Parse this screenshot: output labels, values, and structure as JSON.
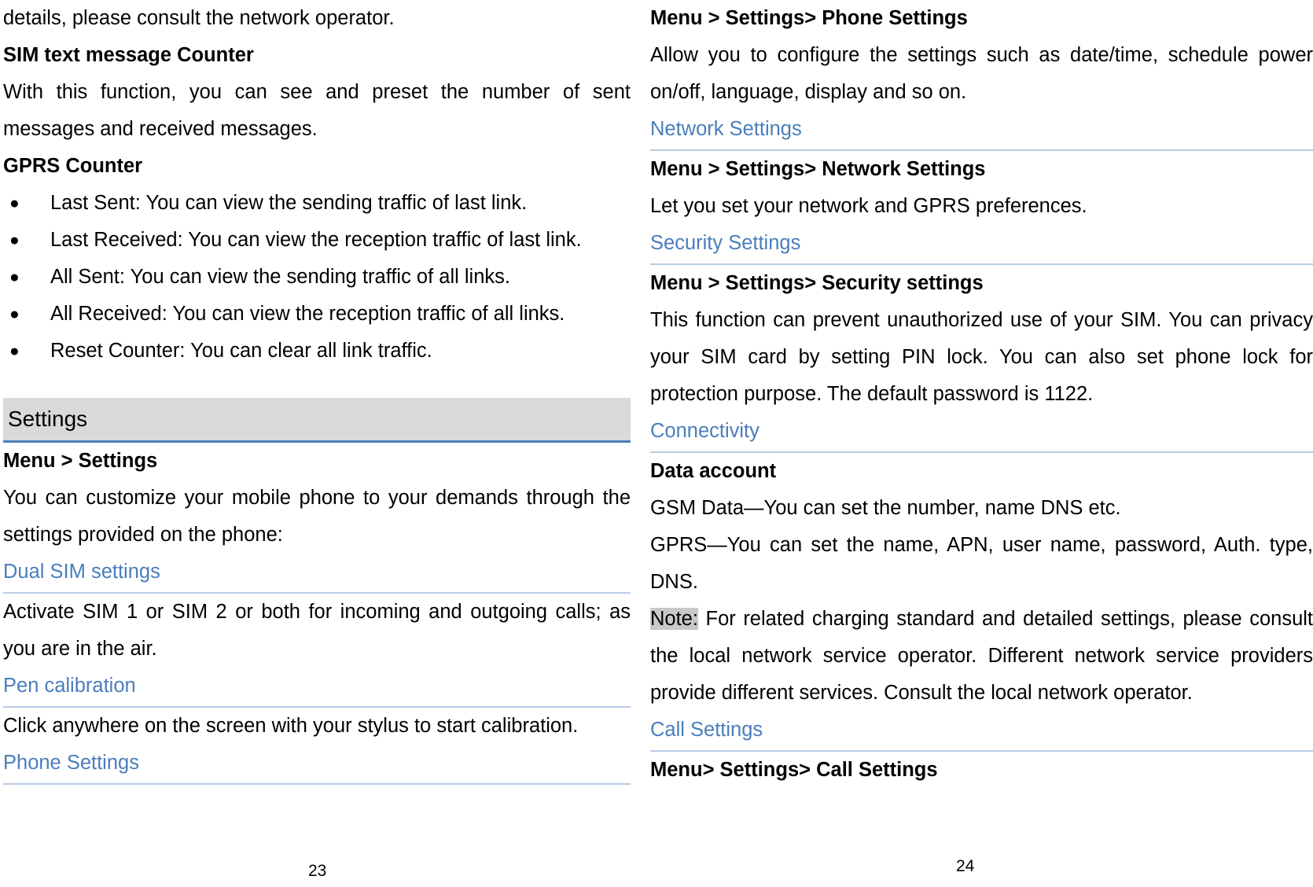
{
  "document": {
    "type": "user-manual",
    "page_numbers": {
      "left": "23",
      "right": "24"
    }
  },
  "left_column": {
    "intro_paragraph": "details, please consult the network operator.",
    "sim_counter_heading": "SIM text message Counter",
    "sim_counter_body": "With this function, you can see and preset the number of sent messages and received messages.",
    "gprs_counter_heading": "GPRS Counter",
    "gprs_bullets": [
      "Last Sent: You can view the sending traffic of last link.",
      "Last Received: You can view the reception traffic of last link.",
      "All Sent: You can view the sending traffic of all links.",
      "All Received: You can view the reception traffic of all links.",
      "Reset Counter: You can clear all link traffic."
    ],
    "settings_banner": "Settings",
    "menu_settings_heading": "Menu > Settings",
    "menu_settings_body": "You can customize your mobile phone to your demands through the settings provided on the phone:",
    "dual_sim_link": "Dual SIM settings",
    "dual_sim_body": "Activate SIM 1 or SIM 2 or both for incoming and outgoing calls; as you are in the air.",
    "pen_calibration_link": "Pen calibration",
    "pen_calibration_body": "Click anywhere on the screen with your stylus to start calibration.",
    "phone_settings_link": "Phone Settings"
  },
  "right_column": {
    "phone_settings_heading": "Menu > Settings> Phone Settings",
    "phone_settings_body": "Allow you to configure the settings such as date/time, schedule power on/off, language, display and so on.",
    "network_settings_link": "Network Settings",
    "network_settings_heading": "Menu > Settings> Network Settings",
    "network_settings_body": "Let you set your network and GPRS preferences.",
    "security_settings_link": "Security Settings",
    "security_settings_heading": "Menu > Settings> Security settings",
    "security_settings_body": "This function can prevent unauthorized use of your SIM. You can privacy your SIM card by setting PIN lock. You can also set phone lock for protection purpose. The default password is 1122.",
    "connectivity_link": "Connectivity",
    "data_account_heading": "Data account",
    "gsm_data_body": "GSM Data—You can set the number, name DNS etc.",
    "gprs_body": "GPRS—You can set the name, APN, user name, password, Auth. type, DNS.",
    "note_label": "Note:",
    "note_body": " For related charging standard and detailed settings, please consult the local network service operator. Different network service providers provide different services. Consult the local network operator.",
    "call_settings_link": "Call Settings",
    "call_settings_heading": "Menu> Settings> Call Settings"
  },
  "colors": {
    "link_blue": "#4a7ebb",
    "divider_blue": "#b8cce4",
    "banner_gray": "#d9d9d9",
    "banner_rule": "#4a7ebb",
    "highlight_gray": "#c8c8c8"
  }
}
